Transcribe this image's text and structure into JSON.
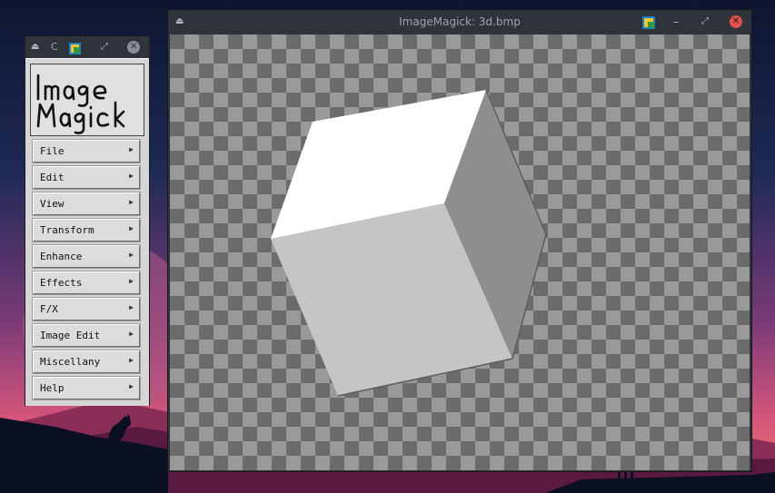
{
  "colors": {
    "titlebar": "#2f333a",
    "close_red": "#e0504d",
    "checker_dark": "#6b6b6b",
    "checker_light": "#9a9a9a",
    "cube_top": "#ffffff",
    "cube_front": "#c4c4c4",
    "cube_side": "#8c8c8c"
  },
  "command_window": {
    "title": "C",
    "logo_line1": "Image",
    "logo_line2": "Magick",
    "menu": [
      {
        "label": "File"
      },
      {
        "label": "Edit"
      },
      {
        "label": "View"
      },
      {
        "label": "Transform"
      },
      {
        "label": "Enhance"
      },
      {
        "label": "Effects"
      },
      {
        "label": "F/X"
      },
      {
        "label": "Image Edit"
      },
      {
        "label": "Miscellany"
      },
      {
        "label": "Help"
      }
    ],
    "submenu_arrow": "▶"
  },
  "image_window": {
    "title": "ImageMagick: 3d.bmp"
  },
  "icons": {
    "shade": "⏏",
    "minimize": "–",
    "maximize": "⤢",
    "close": "✕"
  }
}
